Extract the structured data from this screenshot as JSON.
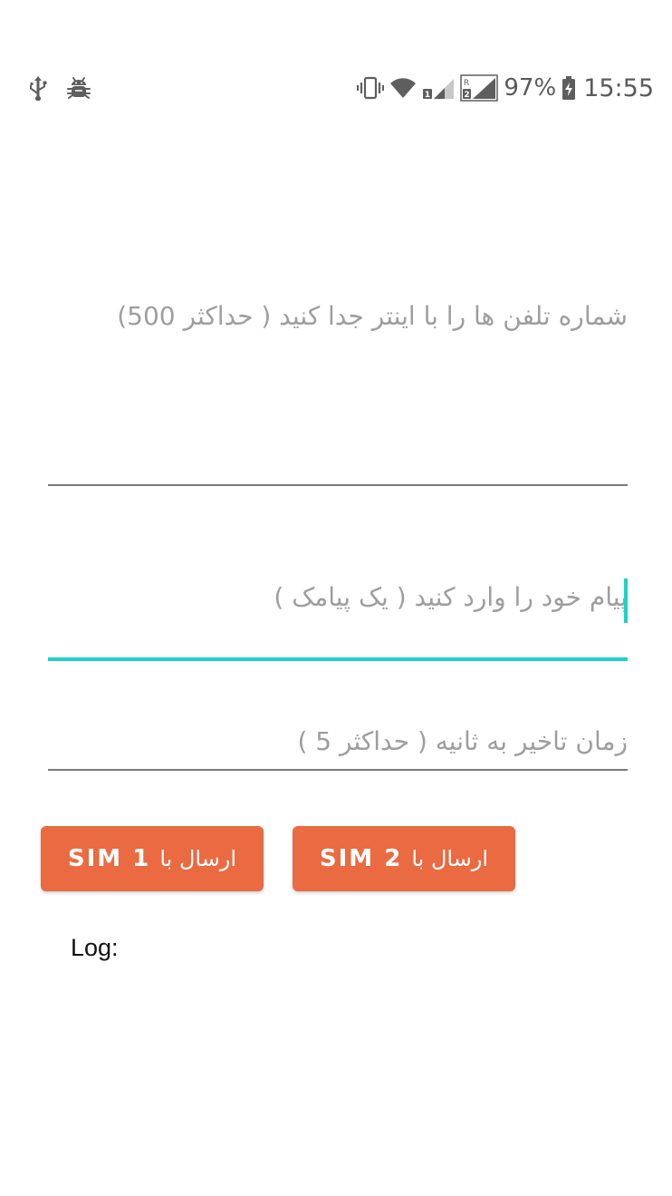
{
  "status_bar": {
    "left_icons": [
      "usb-icon",
      "android-debug-icon"
    ],
    "right_icons": [
      "vibrate-icon",
      "wifi-icon",
      "signal-sim1-icon",
      "signal-sim2-roaming-icon",
      "battery-charging-icon"
    ],
    "battery": "97%",
    "time": "15:55"
  },
  "form": {
    "phones": {
      "placeholder": "شماره تلفن ها را با اینتر جدا کنید ( حداکثر 500)"
    },
    "message": {
      "placeholder": "پیام خود را وارد کنید ( یک پیامک )",
      "focused": true
    },
    "delay": {
      "placeholder": "زمان تاخیر به ثانیه ( حداکثر 5 )"
    }
  },
  "buttons": {
    "sim1": {
      "label_fa": "ارسال با",
      "label_sim": "SIM 1"
    },
    "sim2": {
      "label_fa": "ارسال با",
      "label_sim": "SIM 2"
    }
  },
  "log": {
    "label": "Log:"
  },
  "colors": {
    "accent": "#1fd1c8",
    "button": "#ea6a41",
    "hint": "#9e9e9e"
  }
}
